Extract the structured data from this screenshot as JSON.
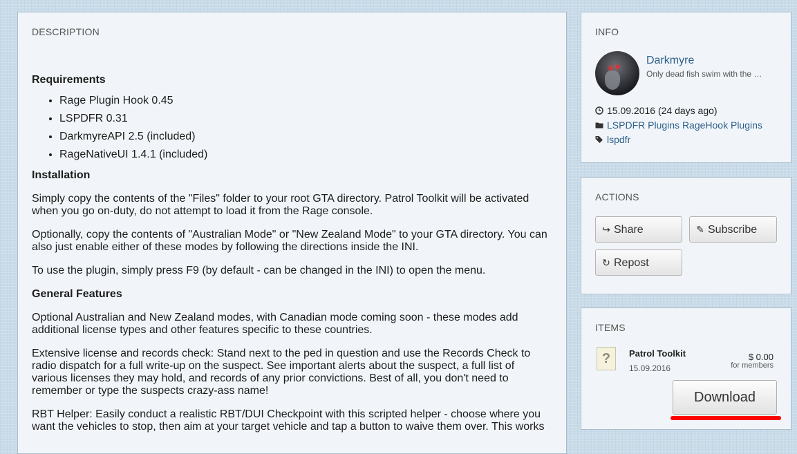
{
  "description": {
    "title": "DESCRIPTION",
    "requirements_heading": "Requirements",
    "requirements": [
      "Rage Plugin Hook 0.45",
      "LSPDFR 0.31",
      "DarkmyreAPI 2.5 (included)",
      "RageNativeUI 1.4.1 (included)"
    ],
    "installation_heading": "Installation",
    "installation_p1": "Simply copy the contents of the \"Files\" folder to your root GTA directory. Patrol Toolkit will be activated when you go on-duty, do not attempt to load it from the Rage console.",
    "installation_p2": "Optionally, copy the contents of \"Australian Mode\" or \"New Zealand Mode\" to your GTA directory. You can also just enable either of these modes by following the directions inside the INI.",
    "installation_p3": "To use the plugin, simply press F9 (by default - can be changed in the INI) to open the menu.",
    "features_heading": "General Features",
    "features_p1": "Optional Australian and New Zealand modes, with Canadian mode coming soon - these modes add additional license types and other features specific to these countries.",
    "features_p2": "Extensive license and records check: Stand next to the ped in question and use the Records Check to radio dispatch for a full write-up on the suspect. See important alerts about the suspect, a full list of various licenses they may hold, and records of any prior convictions. Best of all, you don't need to remember or type the suspects crazy-ass name!",
    "features_p3": "RBT Helper: Easily conduct a realistic RBT/DUI Checkpoint with this scripted helper - choose where you want the vehicles to stop, then aim at your target vehicle and tap a button to waive them over. This works"
  },
  "info": {
    "title": "INFO",
    "username": "Darkmyre",
    "user_title": "Only dead fish swim with the stream",
    "date": "15.09.2016 (24 days ago)",
    "category1": "LSPDFR Plugins",
    "category2": "RageHook Plugins",
    "tag": "lspdfr"
  },
  "actions": {
    "title": "ACTIONS",
    "share": "Share",
    "subscribe": "Subscribe",
    "repost": "Repost"
  },
  "items": {
    "title": "ITEMS",
    "name": "Patrol Toolkit",
    "date": "15.09.2016",
    "price": "$ 0.00",
    "price_note": "for members",
    "download": "Download",
    "file_icon_glyph": "?"
  },
  "colors": {
    "link": "#2b5f8a",
    "highlight": "#ff0000"
  }
}
